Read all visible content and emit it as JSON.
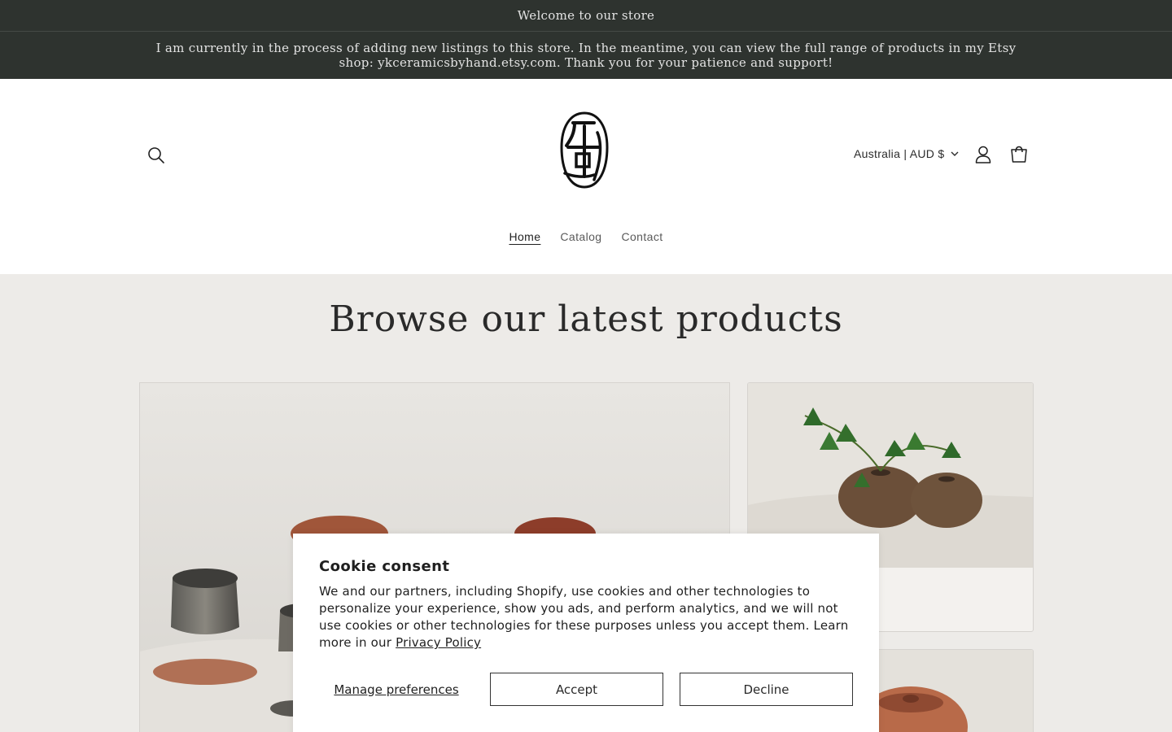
{
  "announcement": {
    "welcome": "Welcome to our store",
    "notice": "I am currently in the process of adding new listings to this store. In the meantime, you can view the full range of products in my Etsy shop: ykceramicsbyhand.etsy.com. Thank you for your patience and support!"
  },
  "header": {
    "currency": "Australia | AUD $",
    "icons": {
      "search": "search-icon",
      "account": "user-icon",
      "cart": "cart-icon",
      "logo": "seal-logo"
    }
  },
  "nav": {
    "items": [
      "Home",
      "Catalog",
      "Contact"
    ],
    "active": "Home"
  },
  "products": {
    "title": "Browse our latest products"
  },
  "cookie": {
    "title": "Cookie consent",
    "body": "We and our partners, including Shopify, use cookies and other technologies to personalize your experience, show you ads, and perform analytics, and we will not use cookies or other technologies for these purposes unless you accept them. Learn more in our ",
    "link": "Privacy Policy",
    "manage": "Manage preferences",
    "accept": "Accept",
    "decline": "Decline"
  },
  "colors": {
    "announcement_bg": "#2e332f",
    "section_bg": "#edebe8",
    "text": "#1f1f1f"
  }
}
